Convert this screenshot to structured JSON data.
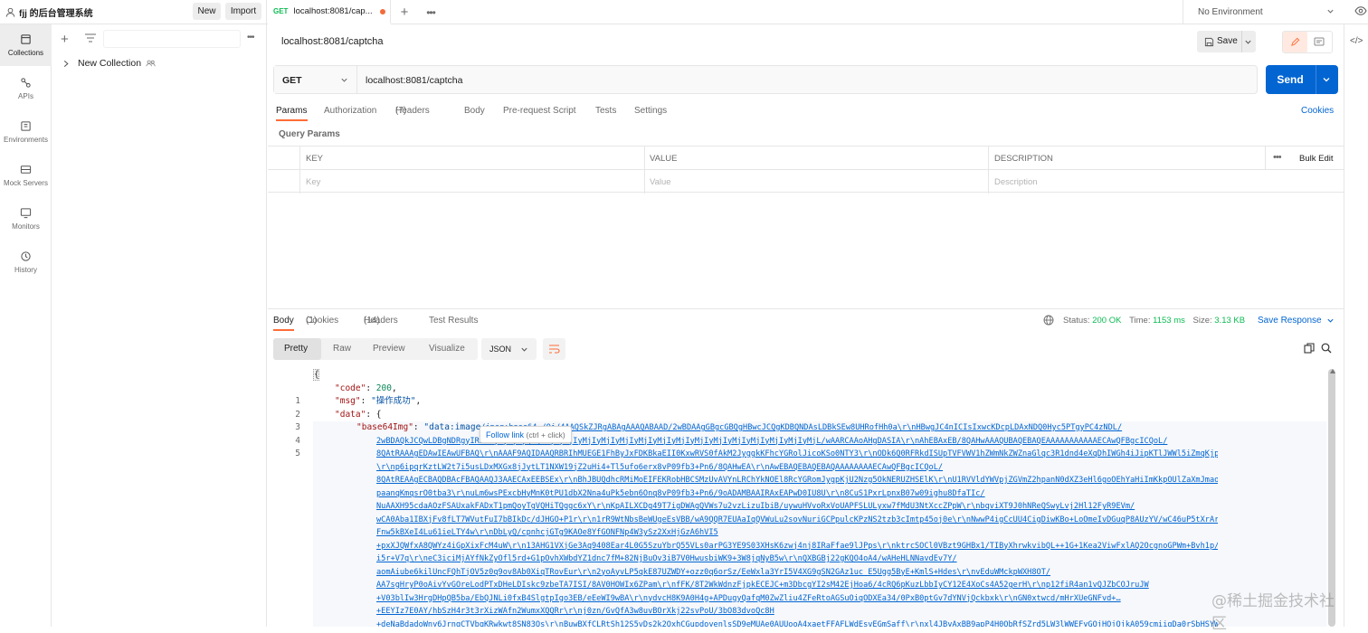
{
  "workspace": {
    "name": "fjj 的后台管理系统",
    "new_label": "New",
    "import_label": "Import"
  },
  "tabs": [
    {
      "method": "GET",
      "label": "localhost:8081/cap..."
    }
  ],
  "environment": "No Environment",
  "rail": [
    {
      "label": "Collections",
      "icon": "collections-icon"
    },
    {
      "label": "APIs",
      "icon": "apis-icon"
    },
    {
      "label": "Environments",
      "icon": "environments-icon"
    },
    {
      "label": "Mock Servers",
      "icon": "mock-servers-icon"
    },
    {
      "label": "Monitors",
      "icon": "monitors-icon"
    },
    {
      "label": "History",
      "icon": "history-icon"
    }
  ],
  "sidebar": {
    "collection": "New Collection"
  },
  "request": {
    "title": "localhost:8081/captcha",
    "save_label": "Save",
    "method": "GET",
    "url": "localhost:8081/captcha",
    "send_label": "Send"
  },
  "request_tabs": {
    "params": "Params",
    "authorization": "Authorization",
    "headers": "Headers",
    "headers_count": "(7)",
    "body": "Body",
    "prerequest": "Pre-request Script",
    "tests": "Tests",
    "settings": "Settings",
    "cookies": "Cookies"
  },
  "query": {
    "title": "Query Params",
    "key": "KEY",
    "value": "VALUE",
    "description": "DESCRIPTION",
    "bulk": "Bulk Edit",
    "ph_key": "Key",
    "ph_value": "Value",
    "ph_desc": "Description"
  },
  "response": {
    "body": "Body",
    "cookies": "Cookies",
    "cookies_count": "(1)",
    "headers": "Headers",
    "headers_count": "(14)",
    "tests": "Test Results",
    "status_label": "Status:",
    "status": "200 OK",
    "time_label": "Time:",
    "time": "1153 ms",
    "size_label": "Size:",
    "size": "3.13 KB",
    "save": "Save Response"
  },
  "view": {
    "pretty": "Pretty",
    "raw": "Raw",
    "preview": "Preview",
    "visualize": "Visualize",
    "format": "JSON"
  },
  "code": {
    "line_numbers": [
      "1",
      "2",
      "3",
      "4",
      "5"
    ],
    "l2_key": "\"code\"",
    "l2_val": "200",
    "l3_key": "\"msg\"",
    "l3_val": "\"操作成功\"",
    "l4_key": "\"data\"",
    "l5_key": "\"base64Img\"",
    "l5_prefix": "\"data:image",
    "l5_link": "/jpeg;base64,/9j/4AAQSkZJRgABAgAAAQABAAD/2wBDAAgGBgcGBQgHBwcJCQgKDBQNDAsLDBkSEw8UHRofHh0a\\r\\nHBwgJC4nICIsIxwcKDcpLDAxNDQ0Hyc5PTgyPC4zNDL/",
    "tooltip": "Follow link",
    "tooltip_hint": "(ctrl + click)",
    "b64_lines": [
      "2wBDAQkJCQwLDBgNDRgyIRwhMjIyMjIy\\r\\nMjIyMjIyMjIyMjIyMjIyMjIyMjIyMjIyMjIyMjIyMjIyMjIyMjIyMjIyMjL/wAARCAAoAHgDASIA\\r\\nAhEBAxEB/8QAHwAAAQUBAQEBAQEAAAAAAAAAAAECAwQFBgcICQoL/",
      "8QAtRAAAgEDAwIEAwUFBAQ\\r\\nAAAF9AQIDAAQRBRIhMUEGE1FhByJxFDKBkaEII0KxwRVS0fAkM2JyggkKFhcYGRolJicoKSo0NTY3\\r\\nODk6Q0RFRkdISUpTVFVWV1hZWmNkZWZnaGlqc3R1dnd4eXqDhIWGh4iJipKTlJWWl5iZmqKjpKWm",
      "\\r\\np6ipqrKztLW2t7i5usLDxMXGx8jJytLT1NXW19jZ2uHi4+Tl5ufo6erx8vP09fb3+Pn6/8QAHwEA\\r\\nAwEBAQEBAQEBAQAAAAAAAAECAwQFBgcICQoL/",
      "8QAtREAAgECBAQDBAcFBAQAAQJ3AAECAxEEBSEx\\r\\nBhJBUQdhcRMiMoEIFEKRobHBCSMzUvAVYnLRChYkNOEl8RcYGRomJygpKjU2Nzg5OkNERUZHSElK\\r\\nU1RVVldYWVpjZGVmZ2hpanN0dXZ3eHl6goOEhYaHiImKkpOUlZaXmJmaoqOk",
      "paanqKmqsrO0tba3\\r\\nuLm6wsPExcbHyMnK0tPU1dbX2Nna4uPk5ebn6Onq8vP09fb3+Pn6/9oADAMBAAIRAxEAPwD0IU8U\\r\\n8CuS1PxrLpnxB07w09ighu8DfaTIc/",
      "NuAAXH95cdaAOzFSAUxakFADxT1pmQoyTgVQHiTQggc6xY\\r\\nKpAILXCDg49T7igDWAgQVWs7u2vzLizuIbiB/uywuHVvoRxVoUAPFSLULyxw7fMdU3NtXccZPpW\\r\\nbqviXT9J0hNReQSwyLvj2Hl12FyR9EVm/",
      "wCA0Aba1IBXjFv8fLT7WVutFuI7bBIkDc/dJHGO+P1r\\r\\n1rR9WtNbsBeWUgeEsVBB/wA9QQR7EUAaIqQVWuLu2sovNuriGCPpulcKPzNS2tzb3cImtp45oj0e\\r\\nNwwP4igCcUU4CigDiwKBo+LoOmeIvDGuqP8AUzYV/wC46uP5tXrArh/",
      "Fnw5kBXeI4Lu61ieLTY4w\\r\\nDbLyQ/cpnhcjGTg9KAOe8YfGONFNp4W3ySz2XxHjGzA6hVI5",
      "+pxXJQWfxA8QWYz4iGpXixFcM4uW\\r\\n13AHG1VXjGe3Aq9408Ear4L0G5SzuYbrQ55VLs0arPG3YE9S03XHsK6zwj4nj8IRaFfae9lJPps\\r\\nktrcSOCl0VBzt9GHBx1/TIByXhrwkvibQL++1G+1Kea2ViwFxlAQ2OcgnoGPWm+Bvh1p/",
      "i5r+V7q\\r\\neC3iciMjAYfNkZyOfl5rd+G1pOvhXWbdYZ1dnc7fM+82NjBuOv3iB7V0HwusbiWK9+3W8jqNyB5w\\r\\nQXBGBj22gKQO4oA4/wAHeHLNNavdEv7Y/",
      "aomAiube6kilUncFQhTjOV5z0q9ov8Ab0XiqTRovEur\\r\\n2yoAyvLP5qkE87UZWDY+ozz0q6orSz/EeWxla3YrI5V4XG9gSN2GAz1uc E5Ugg5ByE+KmlS+Hdes\\r\\nvEduWMckpWXH8OT/",
      "AA7sgHryP0oAivYvGOreLodPTxDHeLDIskc9zbeTA7ISI/8AV0HOWIx6ZPam\\r\\nfFK/8T2WkWdnzFjpkECEJC+m3DbcgYI2sM42EjHoa6/4cRQ6pKuzLbbIyCY12E4XoCs4A52gerH\\r\\np12fiR4an1vQJZbCOJruJW",
      "+V03blIw3HrgDHpQB5ba/EbQJNLi0fxB4SlgtpIgo3EB/eEeWI9wBA\\r\\nydvcH8K9A0H4g+APDugyQafqM0ZwZliu4ZFeRtoAGSuOiqODXEa34/0PxB0ptGv7dYNVjQckbxk\\r\\nGN0xtwcd/mHrXUeGNFvd+…",
      "+EEYIz7E0AY/hbSzH4r3t3rXizWAfn2WumxXQQRr\\r\\nj0zn/GvQfA3w8uvBOrXkj22svPoU/3bO83dvoQc8H",
      "+deNaBdadoWny6JrngCTVbqKRwkwt8SN83Qs\\r\\nBuwBXfCLRtSh12S5vDs2k2OxhCGupdoyenlsSD9eMUAe0AUUooA4xaetFFAFLWdEsvEGmSaff\\r\\nxl4JByAxBB9apP4H0ObRfSZrd5LW3lWWEFyGQjHQjQjkA059cmiigDa0rSbHSYWi"
    ]
  },
  "watermark": "@稀土掘金技术社区"
}
